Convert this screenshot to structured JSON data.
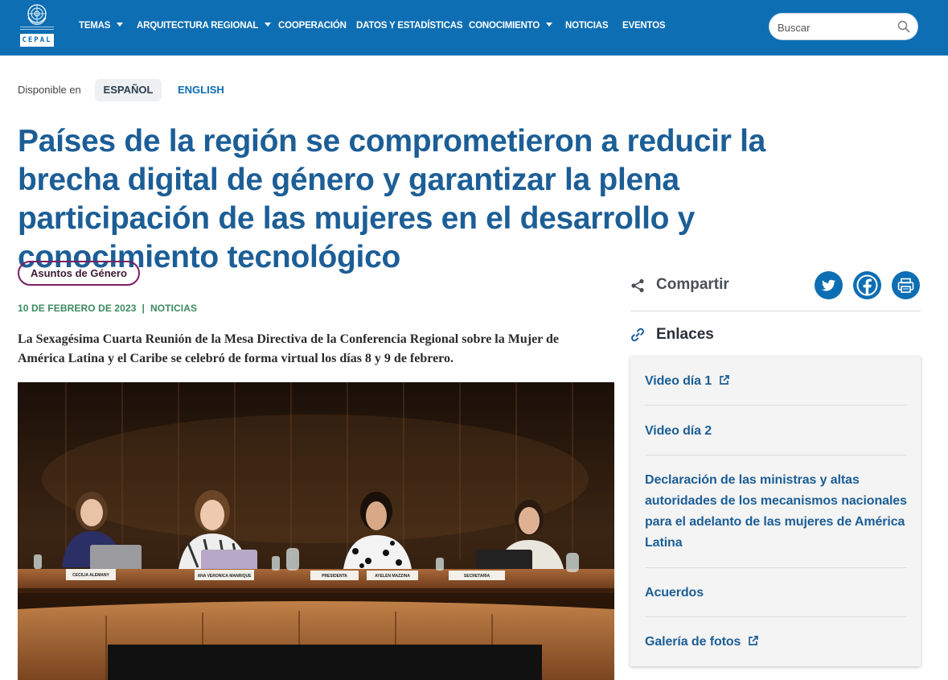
{
  "header": {
    "logo_text": "CEPAL",
    "nav": [
      {
        "label": "TEMAS",
        "dropdown": true
      },
      {
        "label": "ARQUITECTURA REGIONAL",
        "dropdown": true
      },
      {
        "label": "COOPERACIÓN",
        "dropdown": false
      },
      {
        "label": "DATOS Y ESTADÍSTICAS",
        "dropdown": false
      },
      {
        "label": "CONOCIMIENTO",
        "dropdown": true
      },
      {
        "label": "NOTICIAS",
        "dropdown": false
      },
      {
        "label": "EVENTOS",
        "dropdown": false
      }
    ],
    "search_placeholder": "Buscar",
    "search_icon": "search-icon"
  },
  "language": {
    "label": "Disponible en",
    "options": [
      "ESPAÑOL",
      "ENGLISH"
    ],
    "selected": "ESPAÑOL"
  },
  "article": {
    "title": "Países de la región se comprometieron a reducir la brecha digital de género y garantizar la plena participación de las mujeres en el desarrollo y conocimiento tecnológico",
    "tag": "Asuntos de Género",
    "date": "10 DE FEBRERO DE 2023",
    "separator": "|",
    "category": "NOTICIAS",
    "lead": "La Sexagésima Cuarta Reunión de la Mesa Directiva de la Conferencia Regional sobre la Mujer de América Latina y el Caribe se celebró de forma virtual los días 8 y 9 de febrero.",
    "photo_placards": [
      "CECILIA ALEMANY",
      "ANA VERONICA MANRIQUE",
      "PRESIDENTA",
      "AYELEN MAZZINA",
      "SECRETARIA"
    ]
  },
  "sidebar": {
    "share_label": "Compartir",
    "share_buttons": [
      "twitter-icon",
      "facebook-icon",
      "print-icon"
    ],
    "links_label": "Enlaces",
    "links": [
      {
        "label": "Video día 1",
        "external": true
      },
      {
        "label": "Video día 2",
        "external": false
      },
      {
        "label": "Declaración de las ministras y altas autoridades de los mecanismos nacionales para el adelanto de las mujeres de América Latina",
        "external": false
      },
      {
        "label": "Acuerdos",
        "external": false
      },
      {
        "label": "Galería de fotos",
        "external": true
      }
    ]
  },
  "colors": {
    "header_bg": "#0d6eb3",
    "title": "#1c5e96",
    "tag_border": "#7b1f63",
    "meta": "#3c8a5e",
    "link": "#1c5e96"
  }
}
